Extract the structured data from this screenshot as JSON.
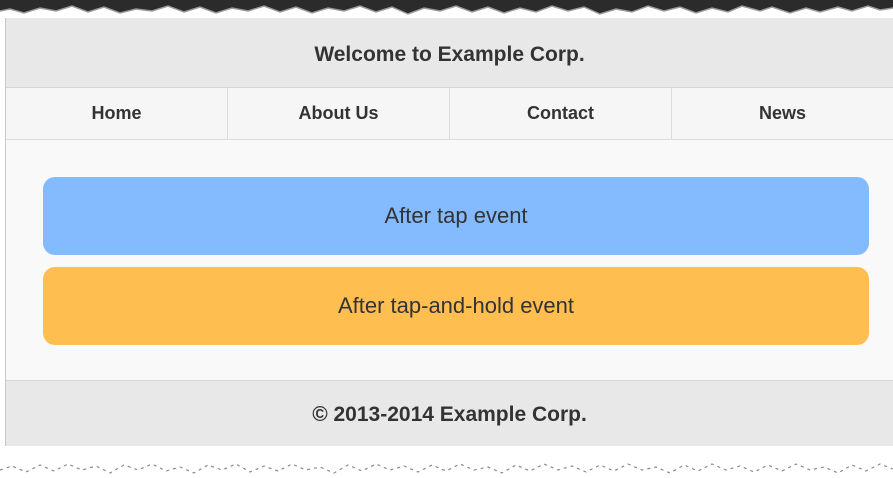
{
  "header": {
    "title": "Welcome to Example Corp."
  },
  "nav": {
    "items": [
      {
        "label": "Home"
      },
      {
        "label": "About Us"
      },
      {
        "label": "Contact"
      },
      {
        "label": "News"
      }
    ]
  },
  "buttons": {
    "tap_label": "After tap event",
    "hold_label": "After tap-and-hold event"
  },
  "footer": {
    "text": "© 2013-2014 Example Corp."
  },
  "colors": {
    "tap_button": "#84bbff",
    "hold_button": "#ffbe4f",
    "bar_background": "#e8e8e8",
    "text": "#333333"
  }
}
